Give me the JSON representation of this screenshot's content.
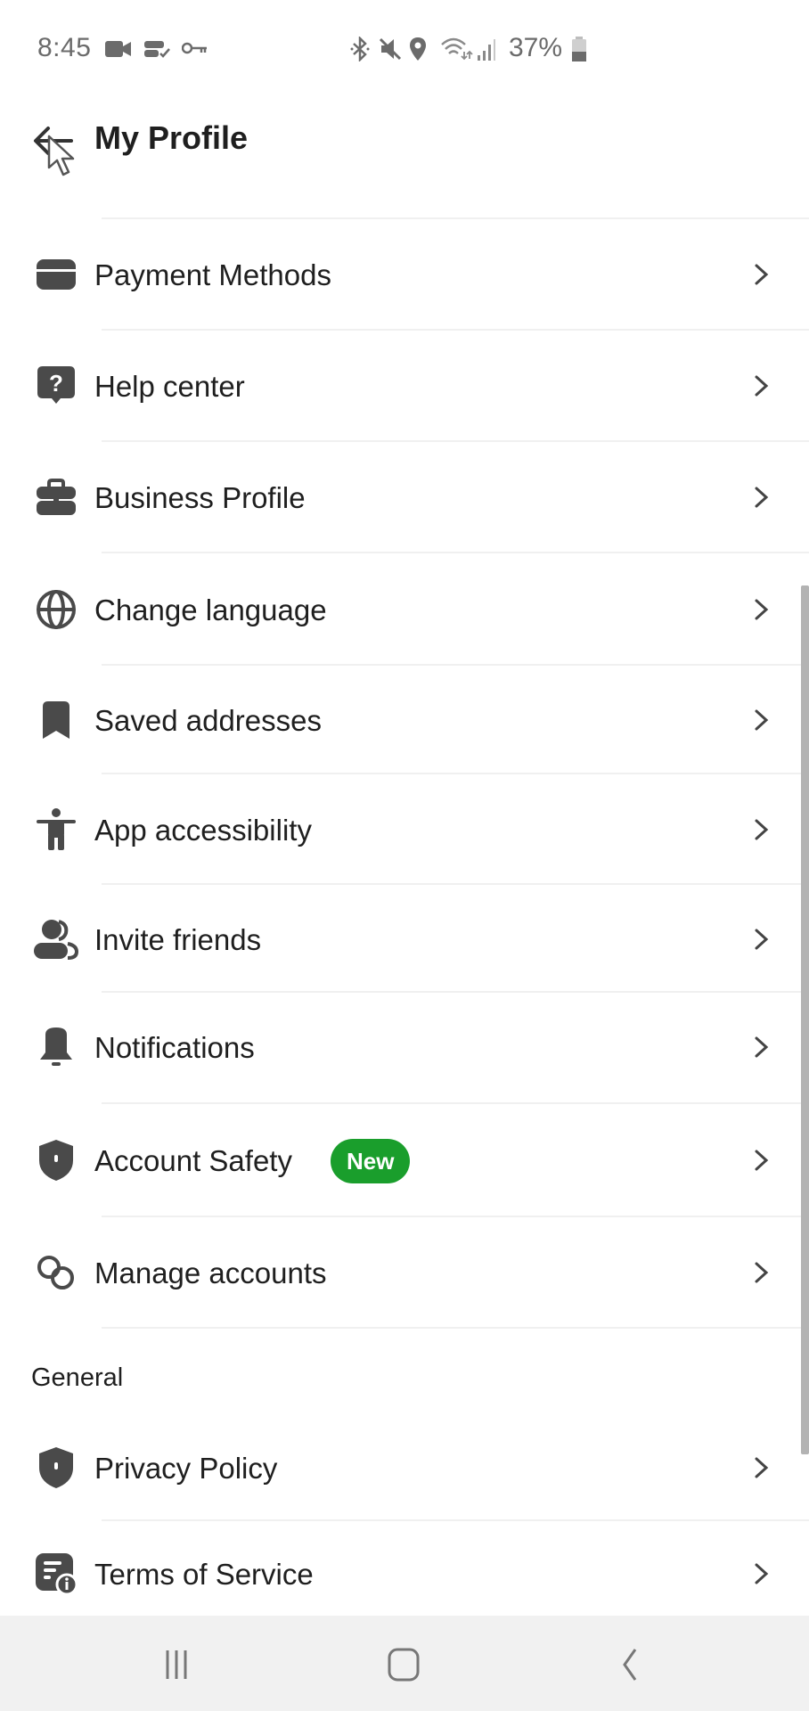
{
  "status_bar": {
    "time": "8:45",
    "battery_percent": "37%",
    "left_icons": [
      "video-record-icon",
      "vpn-sync-icon",
      "key-icon"
    ],
    "right_icons": [
      "bluetooth-icon",
      "mute-icon",
      "location-icon",
      "wifi-icon",
      "signal-icon",
      "battery-icon"
    ]
  },
  "header": {
    "title": "My Profile",
    "back_icon": "arrow-left-icon"
  },
  "menu": {
    "items": [
      {
        "label": "Payment Methods",
        "icon": "credit-card-icon"
      },
      {
        "label": "Help center",
        "icon": "help-bubble-icon"
      },
      {
        "label": "Business Profile",
        "icon": "briefcase-icon"
      },
      {
        "label": "Change language",
        "icon": "globe-icon"
      },
      {
        "label": "Saved addresses",
        "icon": "bookmark-icon"
      },
      {
        "label": "App accessibility",
        "icon": "accessibility-icon"
      },
      {
        "label": "Invite friends",
        "icon": "people-icon"
      },
      {
        "label": "Notifications",
        "icon": "bell-icon"
      },
      {
        "label": "Account Safety",
        "icon": "shield-icon",
        "badge": "New"
      },
      {
        "label": "Manage accounts",
        "icon": "link-accounts-icon"
      }
    ]
  },
  "general": {
    "title": "General",
    "items": [
      {
        "label": "Privacy Policy",
        "icon": "shield-icon"
      },
      {
        "label": "Terms of Service",
        "icon": "document-info-icon"
      }
    ]
  },
  "colors": {
    "badge_green": "#1a9e2c",
    "icon_gray": "#4a4a4a",
    "text": "#1f1f1f"
  },
  "navbar": {
    "buttons": [
      "recent-apps",
      "home",
      "back"
    ]
  }
}
